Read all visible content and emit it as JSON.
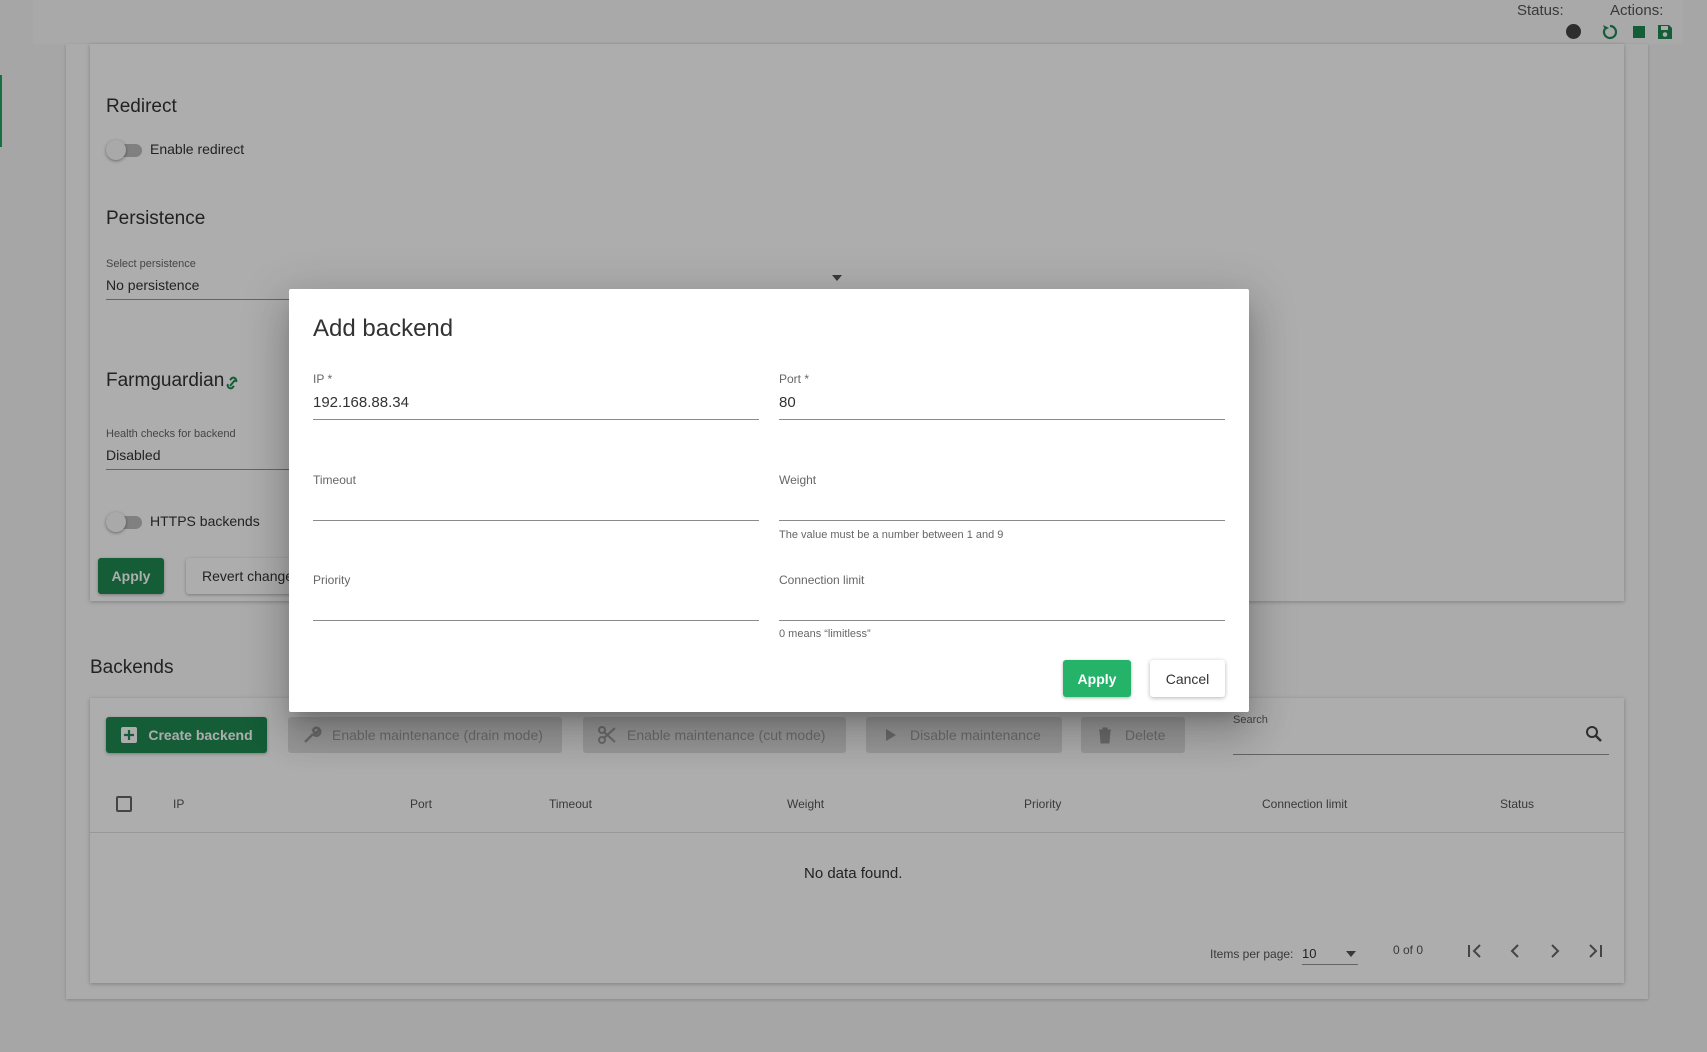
{
  "topbar": {
    "status_label": "Status:",
    "actions_label": "Actions:",
    "accent_color": "#1e8a52"
  },
  "config": {
    "redirect_title": "Redirect",
    "enable_redirect_label": "Enable redirect",
    "persistence_title": "Persistence",
    "persistence_select_label": "Select persistence",
    "persistence_value": "No persistence",
    "farmguardian_title": "Farmguardian",
    "health_label": "Health checks for backend",
    "health_value": "Disabled",
    "https_label": "HTTPS backends",
    "apply_label": "Apply",
    "revert_label": "Revert changes"
  },
  "backends": {
    "title": "Backends",
    "create_label": "Create backend",
    "drain_label": "Enable maintenance (drain mode)",
    "cut_label": "Enable maintenance (cut mode)",
    "disable_label": "Disable maintenance",
    "delete_label": "Delete",
    "search_label": "Search",
    "columns": [
      "IP",
      "Port",
      "Timeout",
      "Weight",
      "Priority",
      "Connection limit",
      "Status"
    ],
    "empty_text": "No data found.",
    "items_per_page_label": "Items per page:",
    "items_per_page_value": "10",
    "range_text": "0 of 0"
  },
  "dialog": {
    "title": "Add backend",
    "ip_label": "IP *",
    "ip_value": "192.168.88.34",
    "port_label": "Port *",
    "port_value": "80",
    "timeout_label": "Timeout",
    "weight_label": "Weight",
    "weight_hint": "The value must be a number between 1 and 9",
    "priority_label": "Priority",
    "connlimit_label": "Connection limit",
    "connlimit_hint": "0 means “limitless”",
    "apply_label": "Apply",
    "cancel_label": "Cancel"
  }
}
